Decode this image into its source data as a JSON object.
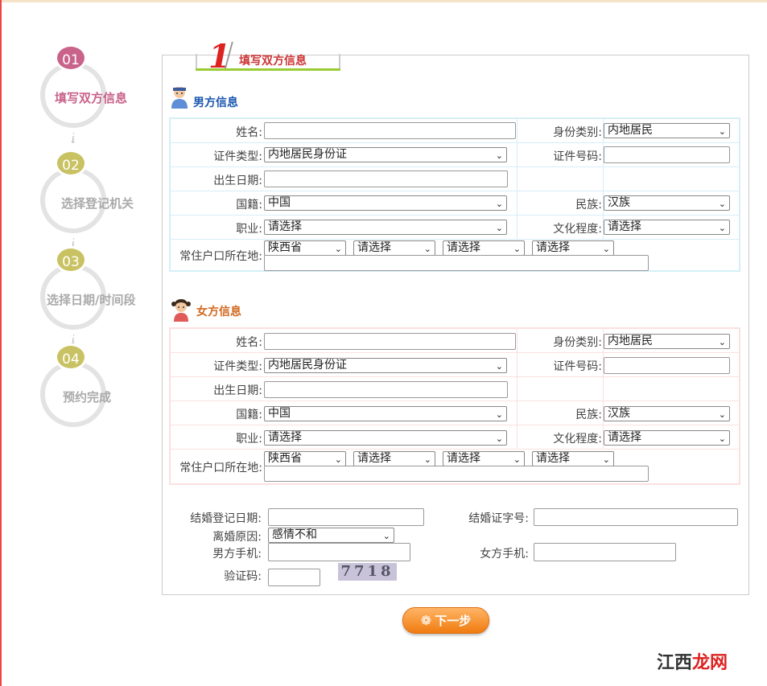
{
  "steps": [
    {
      "num": "01",
      "label": "填写双方信息"
    },
    {
      "num": "02",
      "label": "选择登记机关"
    },
    {
      "num": "03",
      "label": "选择日期/时间段"
    },
    {
      "num": "04",
      "label": "预约完成"
    }
  ],
  "tab": {
    "number": "1",
    "title": "填写双方信息"
  },
  "male": {
    "title": "男方信息",
    "name_label": "姓名:",
    "id_category_label": "身份类别:",
    "id_category_value": "内地居民",
    "doc_type_label": "证件类型:",
    "doc_type_value": "内地居民身份证",
    "doc_no_label": "证件号码:",
    "birth_label": "出生日期:",
    "nationality_label": "国籍:",
    "nationality_value": "中国",
    "ethnicity_label": "民族:",
    "ethnicity_value": "汉族",
    "job_label": "职业:",
    "job_value": "请选择",
    "education_label": "文化程度:",
    "education_value": "请选择",
    "residence_label": "常住户口所在地:",
    "province_value": "陕西省",
    "city_value": "请选择",
    "district_value": "请选择",
    "town_value": "请选择"
  },
  "female": {
    "title": "女方信息",
    "name_label": "姓名:",
    "id_category_label": "身份类别:",
    "id_category_value": "内地居民",
    "doc_type_label": "证件类型:",
    "doc_type_value": "内地居民身份证",
    "doc_no_label": "证件号码:",
    "birth_label": "出生日期:",
    "nationality_label": "国籍:",
    "nationality_value": "中国",
    "ethnicity_label": "民族:",
    "ethnicity_value": "汉族",
    "job_label": "职业:",
    "job_value": "请选择",
    "education_label": "文化程度:",
    "education_value": "请选择",
    "residence_label": "常住户口所在地:",
    "province_value": "陕西省",
    "city_value": "请选择",
    "district_value": "请选择",
    "town_value": "请选择"
  },
  "extra": {
    "marriage_date_label": "结婚登记日期:",
    "marriage_cert_label": "结婚证字号:",
    "divorce_reason_label": "离婚原因:",
    "divorce_reason_value": "感情不和",
    "male_phone_label": "男方手机:",
    "female_phone_label": "女方手机:",
    "captcha_label": "验证码:",
    "captcha_value": "7718"
  },
  "next_button": "下一步",
  "watermark": {
    "a": "江西",
    "b": "龙网"
  }
}
